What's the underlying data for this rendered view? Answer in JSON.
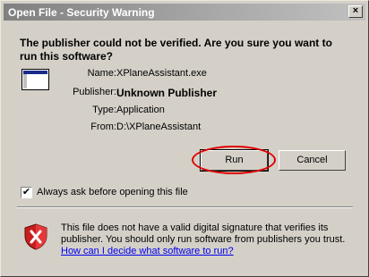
{
  "window": {
    "title": "Open File - Security Warning",
    "close_glyph": "×"
  },
  "heading": "The publisher could not be verified.  Are you sure you want to run this software?",
  "app_icon": "application-window-icon",
  "fields": {
    "name_label": "Name:",
    "name_value": "XPlaneAssistant.exe",
    "publisher_label": "Publisher:",
    "publisher_value": "Unknown Publisher",
    "type_label": "Type:",
    "type_value": "Application",
    "from_label": "From:",
    "from_value": "D:\\XPlaneAssistant"
  },
  "buttons": {
    "run_label": "Run",
    "cancel_label": "Cancel"
  },
  "annotation": {
    "ellipse_color": "#e00000"
  },
  "checkbox": {
    "label": "Always ask before opening this file",
    "checked": true,
    "glyph": "✔"
  },
  "footer": {
    "icon": "shield-warning-icon",
    "text": "This file does not have a valid digital signature that verifies its publisher.  You should only run software from publishers you trust.",
    "link": "How can I decide what software to run?"
  }
}
